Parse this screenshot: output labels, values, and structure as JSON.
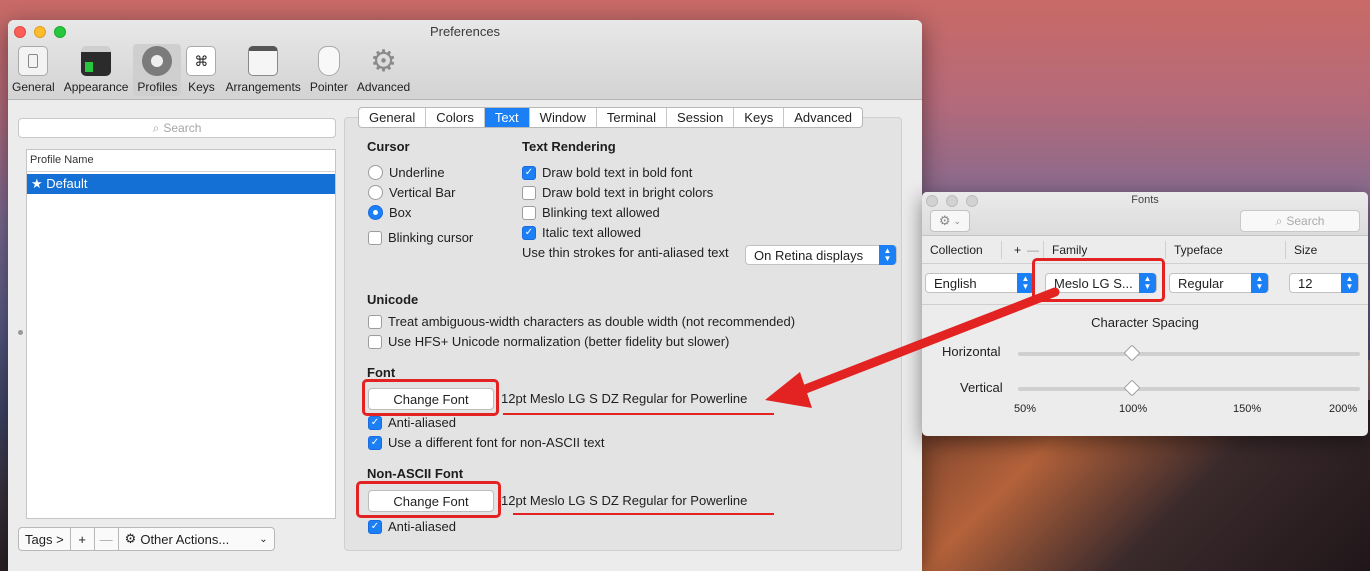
{
  "preferences": {
    "title": "Preferences",
    "toolbar": [
      {
        "label": "General",
        "icon": "general-icon"
      },
      {
        "label": "Appearance",
        "icon": "appearance-icon"
      },
      {
        "label": "Profiles",
        "icon": "profiles-icon"
      },
      {
        "label": "Keys",
        "icon": "keys-icon"
      },
      {
        "label": "Arrangements",
        "icon": "arrangements-icon"
      },
      {
        "label": "Pointer",
        "icon": "pointer-icon"
      },
      {
        "label": "Advanced",
        "icon": "advanced-icon"
      }
    ],
    "search_placeholder": "Search",
    "profile_list": {
      "header": "Profile Name",
      "items": [
        "★ Default"
      ]
    },
    "bottom": {
      "tags": "Tags >",
      "add": "+",
      "remove": "—",
      "other_actions": "Other Actions..."
    },
    "tabs": [
      "General",
      "Colors",
      "Text",
      "Window",
      "Terminal",
      "Session",
      "Keys",
      "Advanced"
    ],
    "cursor": {
      "title": "Cursor",
      "options": [
        "Underline",
        "Vertical Bar",
        "Box"
      ],
      "blinking": "Blinking cursor"
    },
    "text_rendering": {
      "title": "Text Rendering",
      "options": [
        "Draw bold text in bold font",
        "Draw bold text in bright colors",
        "Blinking text allowed",
        "Italic text allowed"
      ],
      "thin_strokes_label": "Use thin strokes for anti-aliased text",
      "thin_strokes_value": "On Retina displays"
    },
    "unicode": {
      "title": "Unicode",
      "ambiguous": "Treat ambiguous-width characters as double width (not recommended)",
      "hfs": "Use HFS+ Unicode normalization (better fidelity but slower)"
    },
    "font": {
      "title": "Font",
      "button": "Change Font",
      "value": "12pt Meslo LG S DZ Regular for Powerline",
      "anti_aliased": "Anti-aliased",
      "non_ascii_toggle": "Use a different font for non-ASCII text"
    },
    "non_ascii_font": {
      "title": "Non-ASCII Font",
      "button": "Change Font",
      "value": "12pt Meslo LG S DZ Regular for Powerline",
      "anti_aliased": "Anti-aliased"
    }
  },
  "fonts_window": {
    "title": "Fonts",
    "search_placeholder": "Search",
    "columns": {
      "collection": "Collection",
      "family": "Family",
      "typeface": "Typeface",
      "size": "Size"
    },
    "collection_value": "English",
    "family_value": "Meslo LG S...",
    "typeface_value": "Regular",
    "size_value": "12",
    "spacing_title": "Character Spacing",
    "horizontal": "Horizontal",
    "vertical": "Vertical",
    "scale": [
      "50%",
      "100%",
      "150%",
      "200%"
    ],
    "horizontal_pct": 100,
    "vertical_pct": 100
  },
  "colors": {
    "accent": "#1b7ff6",
    "annotation": "#e32222"
  }
}
